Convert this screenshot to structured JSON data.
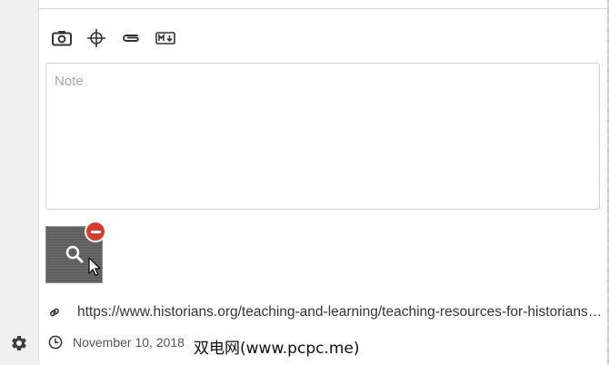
{
  "toolbar": {
    "icons": [
      "camera-icon",
      "crosshair-icon",
      "paperclip-icon",
      "markdown-icon"
    ]
  },
  "note": {
    "placeholder": "Note",
    "value": ""
  },
  "attachment": {
    "icon": "search-icon",
    "remove_icon": "remove-icon"
  },
  "meta": {
    "url": "https://www.historians.org/teaching-and-learning/teaching-resources-for-historians/teaching-and-learning-in-the-digital-age",
    "date": "November 10, 2018"
  },
  "watermark": "双电网(www.pcpc.me)",
  "sidebar": {
    "settings_icon": "gear-icon"
  },
  "colors": {
    "remove": "#d23f31",
    "border": "#cfcfcf"
  }
}
